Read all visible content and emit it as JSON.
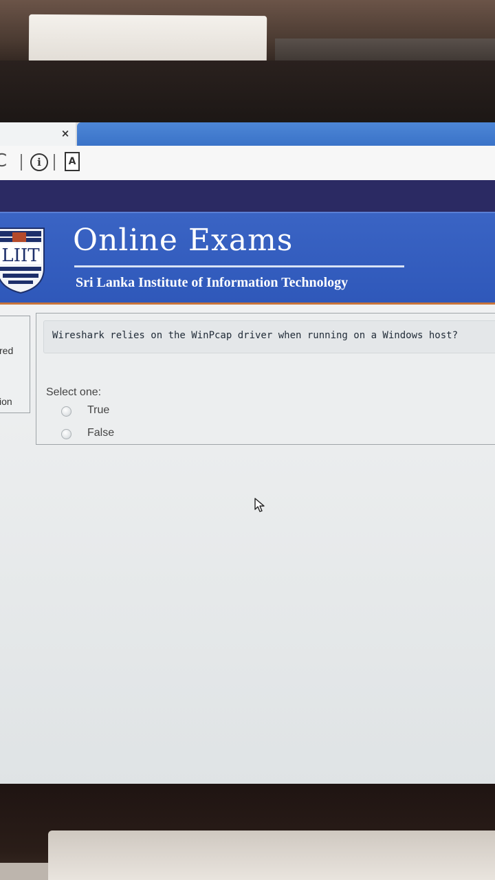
{
  "browser": {
    "tab_close_glyph": "×",
    "reload_glyph": "C",
    "info_glyph": "i",
    "pdf_glyph": "A"
  },
  "banner": {
    "title": "Online Exams",
    "subtitle": "Sri Lanka Institute of Information Technology",
    "logo_text": "LIIT"
  },
  "sidebar": {
    "label_1": "red",
    "label_2": "ion"
  },
  "question": {
    "text": "Wireshark relies on the WinPcap driver when running on a Windows host?",
    "prompt": "Select one:",
    "options": [
      {
        "label": "True",
        "selected": false
      },
      {
        "label": "False",
        "selected": false
      }
    ]
  },
  "colors": {
    "banner": "#2f58ba",
    "navbar": "#2b2a63",
    "accent_orange": "#c8743a"
  },
  "icons": [
    "close-icon",
    "reload-icon",
    "info-icon",
    "pdf-icon",
    "mouse-cursor-icon"
  ]
}
